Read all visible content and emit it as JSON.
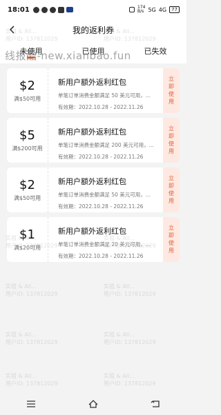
{
  "status_bar": {
    "time": "18:01",
    "network": "174\nB/s",
    "signal": "5G",
    "signal2": "4G",
    "battery": "77"
  },
  "header": {
    "title": "我的返利券"
  },
  "tabs": [
    {
      "label": "未使用",
      "active": true
    },
    {
      "label": "已使用",
      "active": false
    },
    {
      "label": "已失效",
      "active": false
    }
  ],
  "watermark": {
    "url_text": "线报酷-new.xianbao.fun",
    "tile_line1": "实祖 & All...",
    "tile_line2": "用户ID: 137812029"
  },
  "coupons": [
    {
      "amount": "$2",
      "condition": "满$50可用",
      "title": "新用户额外返利红包",
      "desc": "单笔订单消费金额满足 50 美元可用，...",
      "date": "有效期：2022.10.28 - 2022.11.26",
      "action": "立即使用"
    },
    {
      "amount": "$5",
      "condition": "满$200可用",
      "title": "新用户额外返利红包",
      "desc": "单笔订单消费金额满足 200 美元可用，...",
      "date": "有效期：2022.10.28 - 2022.11.26",
      "action": "立即使用"
    },
    {
      "amount": "$2",
      "condition": "满$50可用",
      "title": "新用户额外返利红包",
      "desc": "单笔订单消费金额满足 50 美元可用，...",
      "date": "有效期：2022.10.28 - 2022.11.26",
      "action": "立即使用"
    },
    {
      "amount": "$1",
      "condition": "满$20可用",
      "title": "新用户额外返利红包",
      "desc": "单笔订单消费金额满足 20 美元可用，...",
      "date": "有效期：2022.10.28 - 2022.11.26",
      "action": "立即使用"
    }
  ],
  "colors": {
    "accent": "#ef6a3a",
    "action_bg": "#fde9e1",
    "background": "#f3f3f3"
  },
  "icons": {
    "back": "chevron-left-icon",
    "nav_menu": "menu-icon",
    "nav_home": "home-icon",
    "nav_back": "back-icon"
  }
}
